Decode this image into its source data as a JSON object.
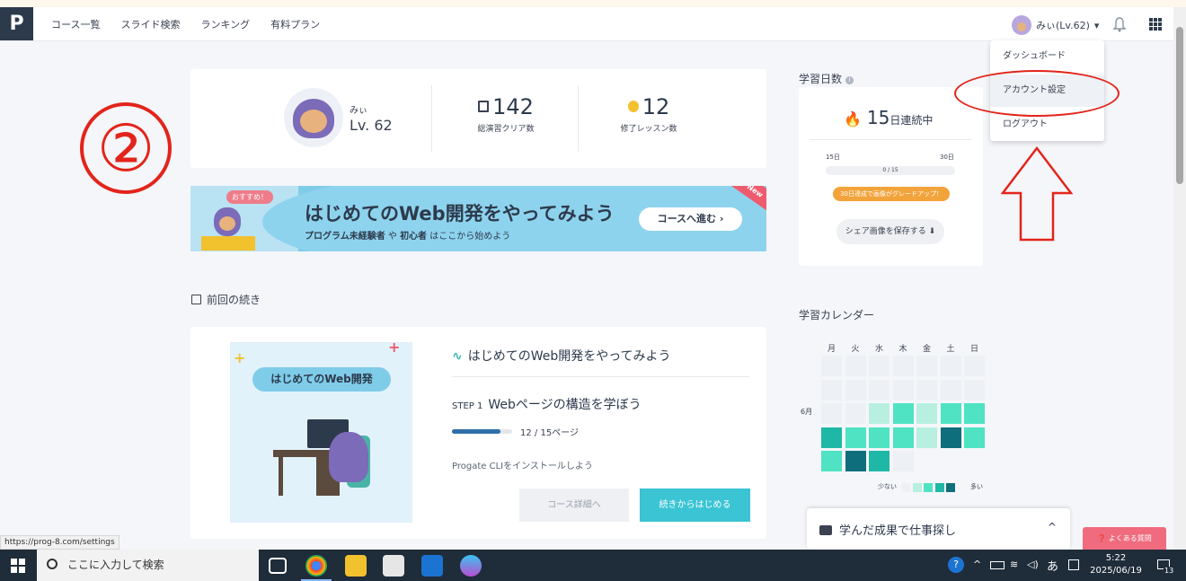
{
  "nav": {
    "logo": "P",
    "links": [
      "コース一覧",
      "スライド検索",
      "ランキング",
      "有料プラン"
    ],
    "user_label": "みぃ(Lv.62)",
    "caret": "▾"
  },
  "dropdown": {
    "items": [
      "ダッシュボード",
      "アカウント設定",
      "ログアウト"
    ]
  },
  "profile": {
    "name": "みぃ",
    "level": "Lv. 62",
    "clear_count": "142",
    "clear_label": "総演習クリア数",
    "lesson_count": "12",
    "lesson_label": "修了レッスン数"
  },
  "banner": {
    "badge": "おすすめ！",
    "title": "はじめてのWeb開発をやってみよう",
    "sub_part1": "プログラム未経験者",
    "sub_part2": " や ",
    "sub_part3": "初心者",
    "sub_part4": " はここから始めよう",
    "button": "コースへ進む ›",
    "new_tag": "New"
  },
  "continue": {
    "section_title": "前回の続き",
    "image_label": "はじめてのWeb開発",
    "course_title": "はじめてのWeb開発をやってみよう",
    "step_label": "STEP 1",
    "step_title": "Webページの構造を学ぼう",
    "progress_fraction": 0.8,
    "progress_text": "12 / 15ページ",
    "next_lesson": "Progate CLIをインストールしよう",
    "detail_button": "コース詳細へ",
    "continue_button": "続きからはじめる"
  },
  "study_days": {
    "title": "学習日数",
    "streak_num": "15",
    "streak_label": "日連続中",
    "label_15": "15日",
    "label_30": "30日",
    "bar_text": "0 / 15",
    "grade_text": "30日達成で画像がグレードアップ！",
    "share_button": "シェア画像を保存する ⬇"
  },
  "calendar": {
    "title": "学習カレンダー",
    "days_of_week": [
      "月",
      "火",
      "水",
      "木",
      "金",
      "土",
      "日"
    ],
    "month": "6月",
    "legend_low": "少ない",
    "legend_high": "多い",
    "colors": [
      "#edf0f5",
      "#b8efe0",
      "#4fe3c3",
      "#1fb8a6",
      "#0f6e7c"
    ],
    "grid": [
      [
        0,
        0,
        0,
        0,
        0,
        0,
        0
      ],
      [
        0,
        0,
        0,
        0,
        0,
        0,
        0
      ],
      [
        0,
        0,
        1,
        2,
        1,
        2,
        2
      ],
      [
        3,
        2,
        2,
        2,
        1,
        4,
        2
      ],
      [
        2,
        4,
        3,
        0,
        -1,
        -1,
        -1
      ]
    ]
  },
  "bottom_panel": {
    "title": "学んだ成果で仕事探し",
    "chevron": "^"
  },
  "faq_button": "❓ よくある質問",
  "status_url": "https://prog-8.com/settings",
  "annotation": {
    "circle_number": "②"
  },
  "taskbar": {
    "search_placeholder": "ここに入力して検索",
    "time": "5:22",
    "date": "2025/06/19",
    "ime": "あ",
    "notifications": "13"
  }
}
